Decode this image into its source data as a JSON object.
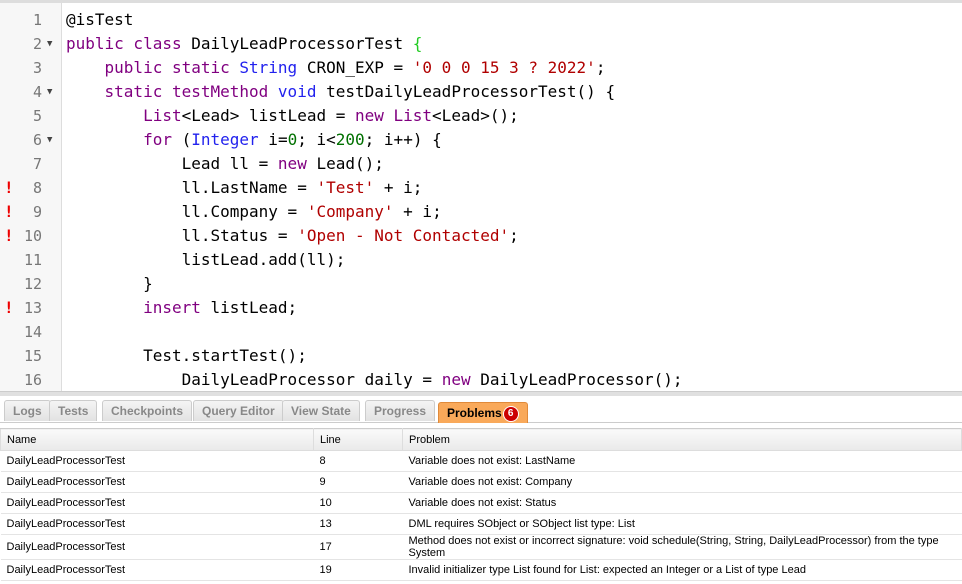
{
  "editor": {
    "lines": [
      {
        "n": "1",
        "fold": false,
        "err": false,
        "tokens": [
          [
            "",
            "@isTest"
          ]
        ]
      },
      {
        "n": "2",
        "fold": true,
        "err": false,
        "tokens": [
          [
            "kw",
            "public class "
          ],
          [
            "",
            "DailyLeadProcessorTest "
          ],
          [
            "br",
            "{"
          ]
        ]
      },
      {
        "n": "3",
        "fold": false,
        "err": false,
        "tokens": [
          [
            "",
            "    "
          ],
          [
            "kw",
            "public static "
          ],
          [
            "ty",
            "String"
          ],
          [
            "",
            " CRON_EXP = "
          ],
          [
            "str",
            "'0 0 0 15 3 ? 2022'"
          ],
          [
            "",
            ";"
          ]
        ]
      },
      {
        "n": "4",
        "fold": true,
        "err": false,
        "tokens": [
          [
            "",
            "    "
          ],
          [
            "kw",
            "static testMethod "
          ],
          [
            "ty",
            "void"
          ],
          [
            "",
            " testDailyLeadProcessorTest() {"
          ]
        ]
      },
      {
        "n": "5",
        "fold": false,
        "err": false,
        "tokens": [
          [
            "",
            "        "
          ],
          [
            "kw",
            "List"
          ],
          [
            "",
            "<Lead> listLead = "
          ],
          [
            "kw",
            "new List"
          ],
          [
            "",
            "<Lead>();"
          ]
        ]
      },
      {
        "n": "6",
        "fold": true,
        "err": false,
        "tokens": [
          [
            "",
            "        "
          ],
          [
            "kw",
            "for"
          ],
          [
            "",
            " ("
          ],
          [
            "ty",
            "Integer"
          ],
          [
            "",
            " i="
          ],
          [
            "num",
            "0"
          ],
          [
            "",
            "; i<"
          ],
          [
            "num",
            "200"
          ],
          [
            "",
            "; i++) {"
          ]
        ]
      },
      {
        "n": "7",
        "fold": false,
        "err": false,
        "tokens": [
          [
            "",
            "            Lead ll = "
          ],
          [
            "kw",
            "new"
          ],
          [
            "",
            " Lead();"
          ]
        ]
      },
      {
        "n": "8",
        "fold": false,
        "err": true,
        "tokens": [
          [
            "",
            "            ll.LastName = "
          ],
          [
            "str",
            "'Test'"
          ],
          [
            "",
            " + i;"
          ]
        ]
      },
      {
        "n": "9",
        "fold": false,
        "err": true,
        "tokens": [
          [
            "",
            "            ll.Company = "
          ],
          [
            "str",
            "'Company'"
          ],
          [
            "",
            " + i;"
          ]
        ]
      },
      {
        "n": "10",
        "fold": false,
        "err": true,
        "tokens": [
          [
            "",
            "            ll.Status = "
          ],
          [
            "str",
            "'Open - Not Contacted'"
          ],
          [
            "",
            ";"
          ]
        ]
      },
      {
        "n": "11",
        "fold": false,
        "err": false,
        "tokens": [
          [
            "",
            "            listLead.add(ll);"
          ]
        ]
      },
      {
        "n": "12",
        "fold": false,
        "err": false,
        "tokens": [
          [
            "",
            "        }"
          ]
        ]
      },
      {
        "n": "13",
        "fold": false,
        "err": true,
        "tokens": [
          [
            "",
            "        "
          ],
          [
            "kw",
            "insert"
          ],
          [
            "",
            " listLead;"
          ]
        ]
      },
      {
        "n": "14",
        "fold": false,
        "err": false,
        "tokens": []
      },
      {
        "n": "15",
        "fold": false,
        "err": false,
        "tokens": [
          [
            "",
            "        Test.startTest();"
          ]
        ]
      },
      {
        "n": "16",
        "fold": false,
        "err": false,
        "tokens": [
          [
            "",
            "            DailyLeadProcessor daily = "
          ],
          [
            "kw",
            "new"
          ],
          [
            "",
            " DailyLeadProcessor();"
          ]
        ]
      }
    ],
    "error_marker": "!",
    "fold_glyph": "▼"
  },
  "tabs": [
    {
      "label": "Logs"
    },
    {
      "label": "Tests"
    },
    {
      "label": "Checkpoints"
    },
    {
      "label": "Query Editor"
    },
    {
      "label": "View State"
    },
    {
      "label": "Progress"
    },
    {
      "label": "Problems",
      "badge": "6",
      "active": true
    }
  ],
  "problems": {
    "headers": [
      "Name",
      "Line",
      "Problem"
    ],
    "rows": [
      [
        "DailyLeadProcessorTest",
        "8",
        "Variable does not exist: LastName"
      ],
      [
        "DailyLeadProcessorTest",
        "9",
        "Variable does not exist: Company"
      ],
      [
        "DailyLeadProcessorTest",
        "10",
        "Variable does not exist: Status"
      ],
      [
        "DailyLeadProcessorTest",
        "13",
        "DML requires SObject or SObject list type: List"
      ],
      [
        "DailyLeadProcessorTest",
        "17",
        "Method does not exist or incorrect signature: void schedule(String, String, DailyLeadProcessor) from the type System"
      ],
      [
        "DailyLeadProcessorTest",
        "19",
        "Invalid initializer type List found for List: expected an Integer or a List of type Lead"
      ]
    ]
  },
  "colors": {
    "active_tab": "#f9a95a",
    "badge": "#cc0000",
    "error": "#ee0000"
  }
}
